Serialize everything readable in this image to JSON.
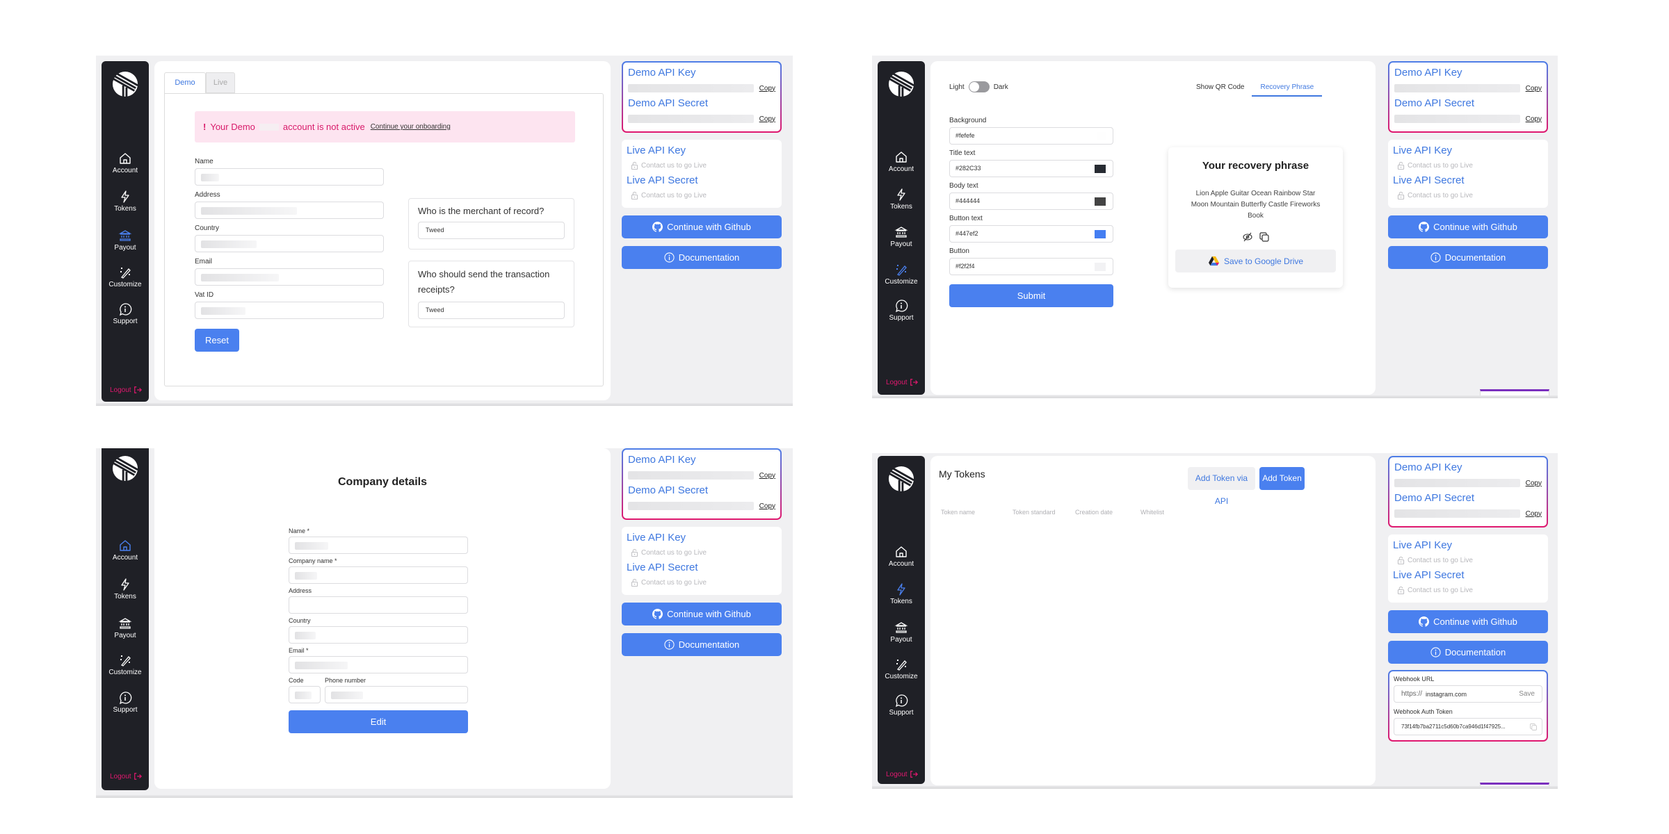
{
  "sidebar": {
    "items": [
      {
        "label": "Account",
        "icon": "home-icon"
      },
      {
        "label": "Tokens",
        "icon": "lightning-icon"
      },
      {
        "label": "Payout",
        "icon": "bank-icon"
      },
      {
        "label": "Customize",
        "icon": "magic-wand-icon"
      },
      {
        "label": "Support",
        "icon": "info-chat-icon"
      }
    ],
    "logout_label": "Logout"
  },
  "rail": {
    "demo_key_title": "Demo API Key",
    "demo_secret_title": "Demo API Secret",
    "copy_label": "Copy",
    "live_key_title": "Live API Key",
    "live_secret_title": "Live API Secret",
    "contact_label": "Contact us to go Live",
    "github_label": "Continue with Github",
    "docs_label": "Documentation",
    "webhook": {
      "url_label": "Webhook URL",
      "url_prefix": "https://",
      "url_value": "instagram.com",
      "save_label": "Save",
      "token_label": "Webhook Auth Token",
      "token_value": "73f14fb7ba2711c5d60b7ca946d1f47925..."
    }
  },
  "payout": {
    "tabs": [
      {
        "label": "Demo",
        "active": true
      },
      {
        "label": "Live",
        "active": false
      }
    ],
    "alert_prefix": "Your Demo",
    "alert_suffix": "account is not active",
    "alert_link": "Continue your onboarding",
    "fields": [
      {
        "label": "Name"
      },
      {
        "label": "Address"
      },
      {
        "label": "Country"
      },
      {
        "label": "Email"
      },
      {
        "label": "Vat ID"
      }
    ],
    "merchant_question": "Who is the merchant of record?",
    "merchant_value": "Tweed",
    "receipts_question": "Who should send the transaction receipts?",
    "receipts_value": "Tweed",
    "reset_label": "Reset"
  },
  "customize": {
    "toggle_light": "Light",
    "toggle_dark": "Dark",
    "dark_mode": false,
    "fields": [
      {
        "label": "Background",
        "value": "#fefefe",
        "swatch": "#fefefe"
      },
      {
        "label": "Title text",
        "value": "#282C33",
        "swatch": "#282c33"
      },
      {
        "label": "Body text",
        "value": "#444444",
        "swatch": "#444444"
      },
      {
        "label": "Button text",
        "value": "#447ef2",
        "swatch": "#447ef2"
      },
      {
        "label": "Button",
        "value": "#f2f2f4",
        "swatch": "#f2f2f4"
      }
    ],
    "submit_label": "Submit",
    "tabs": [
      {
        "label": "Show QR Code",
        "active": false
      },
      {
        "label": "Recovery Phrase",
        "active": true
      }
    ],
    "preview_title": "Your recovery phrase",
    "preview_phrase": "Lion Apple Guitar Ocean Rainbow Star Moon Mountain Butterfly Castle Fireworks Book",
    "drive_label": "Save to Google Drive"
  },
  "company": {
    "title": "Company details",
    "fields": [
      {
        "label": "Name *"
      },
      {
        "label": "Company name *"
      },
      {
        "label": "Address"
      },
      {
        "label": "Country"
      },
      {
        "label": "Email *"
      }
    ],
    "code_label": "Code",
    "phone_label": "Phone number",
    "edit_label": "Edit"
  },
  "tokens": {
    "title": "My Tokens",
    "add_api_label": "Add Token via API",
    "add_label": "Add Token",
    "columns": [
      "Token name",
      "Token standard",
      "Creation date",
      "Whitelist"
    ]
  },
  "colors": {
    "accent": "#4a80ef",
    "sidebar_bg": "#1f2026",
    "logout": "#e0186e",
    "alert_bg": "#fde4f0",
    "alert_text": "#d81b6a"
  }
}
